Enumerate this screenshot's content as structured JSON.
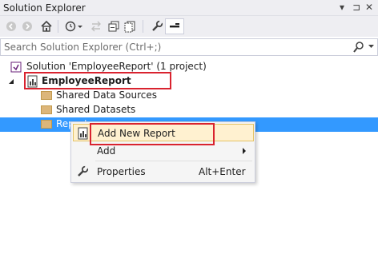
{
  "window": {
    "title": "Solution Explorer",
    "controls": [
      "▾",
      "⊐",
      "✕"
    ]
  },
  "search": {
    "placeholder": "Search Solution Explorer (Ctrl+;)"
  },
  "tree": {
    "solution_label": "Solution 'EmployeeReport' (1 project)",
    "project_label": "EmployeeReport",
    "items": [
      "Shared Data Sources",
      "Shared Datasets",
      "Reports"
    ]
  },
  "context_menu": {
    "add_new_report": "Add New Report",
    "add": "Add",
    "properties": "Properties",
    "properties_shortcut": "Alt+Enter"
  },
  "colors": {
    "selection": "#3399ff",
    "highlight_box": "#d9232f",
    "menu_hover": "#fff1d0"
  }
}
